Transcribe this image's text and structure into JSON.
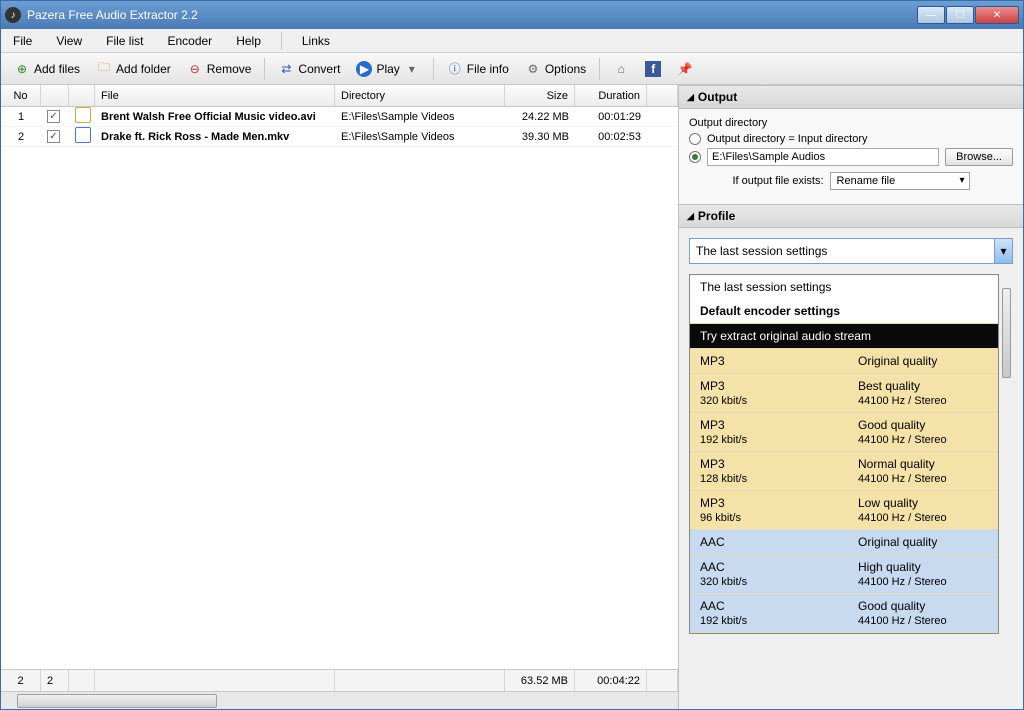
{
  "window": {
    "title": "Pazera Free Audio Extractor 2.2"
  },
  "menu": [
    "File",
    "View",
    "File list",
    "Encoder",
    "Help",
    "Links"
  ],
  "toolbar": {
    "add_files": "Add files",
    "add_folder": "Add folder",
    "remove": "Remove",
    "convert": "Convert",
    "play": "Play",
    "file_info": "File info",
    "options": "Options"
  },
  "grid": {
    "headers": {
      "no": "No",
      "file": "File",
      "dir": "Directory",
      "size": "Size",
      "dur": "Duration"
    },
    "rows": [
      {
        "no": "1",
        "checked": true,
        "file": "Brent Walsh  Free Official Music video.avi",
        "dir": "E:\\Files\\Sample Videos",
        "size": "24.22 MB",
        "dur": "00:01:29"
      },
      {
        "no": "2",
        "checked": true,
        "file": "Drake ft. Rick Ross - Made Men.mkv",
        "dir": "E:\\Files\\Sample Videos",
        "size": "39.30 MB",
        "dur": "00:02:53"
      }
    ],
    "footer": {
      "count1": "2",
      "count2": "2",
      "size": "63.52 MB",
      "dur": "00:04:22"
    }
  },
  "output": {
    "panel": "Output",
    "label": "Output directory",
    "opt_same": "Output directory = Input directory",
    "path": "E:\\Files\\Sample Audios",
    "browse": "Browse...",
    "exists_label": "If output file exists:",
    "exists_value": "Rename file"
  },
  "profile": {
    "panel": "Profile",
    "selected": "The last session settings",
    "items": [
      {
        "type": "plain",
        "l": "The last session settings"
      },
      {
        "type": "header",
        "l": "Default encoder settings"
      },
      {
        "type": "sel",
        "l": "Try extract original audio stream"
      },
      {
        "type": "mp3",
        "l": "MP3",
        "r": "Original quality"
      },
      {
        "type": "mp3",
        "l": "MP3",
        "sub": "320 kbit/s",
        "r": "Best quality",
        "rsub": "44100 Hz / Stereo"
      },
      {
        "type": "mp3",
        "l": "MP3",
        "sub": "192 kbit/s",
        "r": "Good quality",
        "rsub": "44100 Hz / Stereo"
      },
      {
        "type": "mp3",
        "l": "MP3",
        "sub": "128 kbit/s",
        "r": "Normal quality",
        "rsub": "44100 Hz / Stereo"
      },
      {
        "type": "mp3",
        "l": "MP3",
        "sub": "96 kbit/s",
        "r": "Low quality",
        "rsub": "44100 Hz / Stereo"
      },
      {
        "type": "aac",
        "l": "AAC",
        "r": "Original quality"
      },
      {
        "type": "aac",
        "l": "AAC",
        "sub": "320 kbit/s",
        "r": "High quality",
        "rsub": "44100 Hz / Stereo"
      },
      {
        "type": "aac",
        "l": "AAC",
        "sub": "192 kbit/s",
        "r": "Good quality",
        "rsub": "44100 Hz / Stereo"
      }
    ]
  }
}
